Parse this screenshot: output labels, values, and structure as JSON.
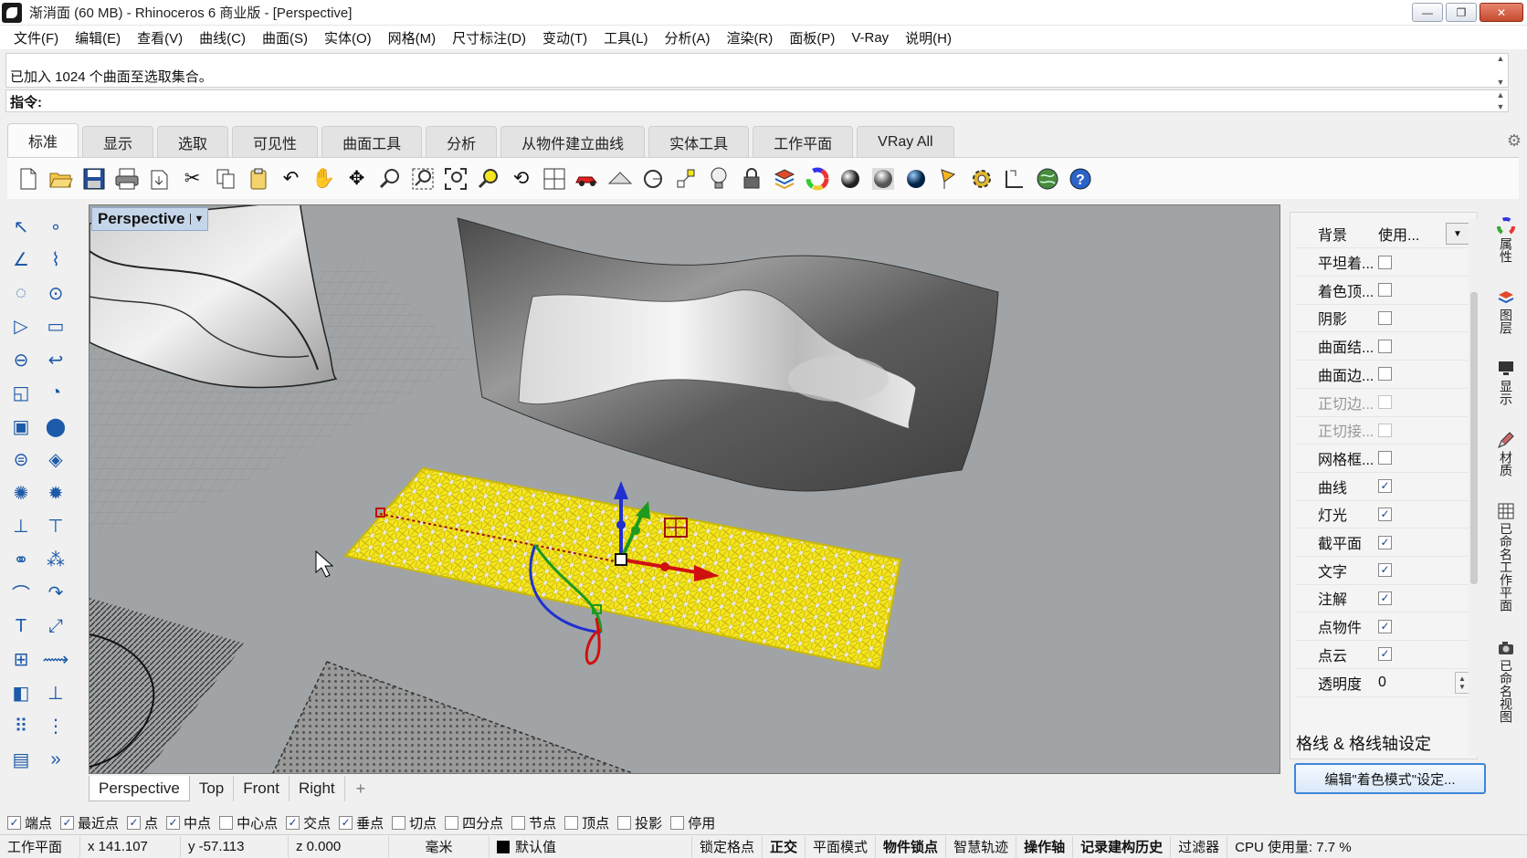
{
  "window": {
    "title": "渐消面 (60 MB) - Rhinoceros 6 商业版 - [Perspective]",
    "buttons": {
      "minimize": "—",
      "restore": "❐",
      "close": "✕"
    }
  },
  "menu": [
    "文件(F)",
    "编辑(E)",
    "查看(V)",
    "曲线(C)",
    "曲面(S)",
    "实体(O)",
    "网格(M)",
    "尺寸标注(D)",
    "变动(T)",
    "工具(L)",
    "分析(A)",
    "渲染(R)",
    "面板(P)",
    "V-Ray",
    "说明(H)"
  ],
  "command": {
    "history": "已加入 1024 个曲面至选取集合。",
    "prompt": "指令:"
  },
  "tabs": [
    "标准",
    "显示",
    "选取",
    "可见性",
    "曲面工具",
    "分析",
    "从物件建立曲线",
    "实体工具",
    "工作平面",
    "VRay All"
  ],
  "toolbar_icons": [
    "new-file-icon",
    "open-icon",
    "save-icon",
    "print-icon",
    "import-icon",
    "cut-icon",
    "copy-icon",
    "paste-icon",
    "undo-icon",
    "pan-icon",
    "rotate-view-icon",
    "zoom-icon",
    "zoom-window-icon",
    "zoom-extents-icon",
    "zoom-selected-icon",
    "rotate-icon",
    "four-views-icon",
    "car-icon",
    "plane-icon",
    "circle-icon",
    "snap-icon",
    "light-icon",
    "lock-icon",
    "layer-icon",
    "color-wheel-icon",
    "sphere-icon",
    "shaded-sphere-icon",
    "render-sphere-icon",
    "flag-icon",
    "gear-icon",
    "dimension-icon",
    "globe-icon",
    "help-icon"
  ],
  "viewport": {
    "label": "Perspective",
    "tabs": [
      "Perspective",
      "Top",
      "Front",
      "Right"
    ],
    "add_tab": "+"
  },
  "display_panel": {
    "background_label": "背景",
    "background_value": "使用...",
    "rows": [
      {
        "label": "平坦着...",
        "checked": false,
        "dim": false
      },
      {
        "label": "着色顶...",
        "checked": false,
        "dim": false
      },
      {
        "label": "阴影",
        "checked": false,
        "dim": false
      },
      {
        "label": "曲面结...",
        "checked": false,
        "dim": false
      },
      {
        "label": "曲面边...",
        "checked": false,
        "dim": false
      },
      {
        "label": "正切边...",
        "checked": false,
        "dim": true
      },
      {
        "label": "正切接...",
        "checked": false,
        "dim": true
      },
      {
        "label": "网格框...",
        "checked": false,
        "dim": false
      },
      {
        "label": "曲线",
        "checked": true,
        "dim": false
      },
      {
        "label": "灯光",
        "checked": true,
        "dim": false
      },
      {
        "label": "截平面",
        "checked": true,
        "dim": false
      },
      {
        "label": "文字",
        "checked": true,
        "dim": false
      },
      {
        "label": "注解",
        "checked": true,
        "dim": false
      },
      {
        "label": "点物件",
        "checked": true,
        "dim": false
      },
      {
        "label": "点云",
        "checked": true,
        "dim": false
      }
    ],
    "transparency_label": "透明度",
    "transparency_value": "0",
    "section": "格线 & 格线轴设定",
    "edit_button": "编辑\"着色模式\"设定..."
  },
  "right_tabs": [
    "属性",
    "图层",
    "显示",
    "材质",
    "已命名工作平面",
    "已命名视图"
  ],
  "osnap": [
    {
      "label": "端点",
      "checked": true
    },
    {
      "label": "最近点",
      "checked": true
    },
    {
      "label": "点",
      "checked": true
    },
    {
      "label": "中点",
      "checked": true
    },
    {
      "label": "中心点",
      "checked": false
    },
    {
      "label": "交点",
      "checked": true
    },
    {
      "label": "垂点",
      "checked": true
    },
    {
      "label": "切点",
      "checked": false
    },
    {
      "label": "四分点",
      "checked": false
    },
    {
      "label": "节点",
      "checked": false
    },
    {
      "label": "顶点",
      "checked": false
    },
    {
      "label": "投影",
      "checked": false
    },
    {
      "label": "停用",
      "checked": false
    }
  ],
  "status": {
    "cplane": "工作平面",
    "x": "x 141.107",
    "y": "y -57.113",
    "z": "z 0.000",
    "unit": "毫米",
    "layer": "默认值",
    "grid_snap": "锁定格点",
    "ortho": "正交",
    "planar": "平面模式",
    "osnap": "物件锁点",
    "smarttrack": "智慧轨迹",
    "gumball": "操作轴",
    "history": "记录建构历史",
    "filter": "过滤器",
    "cpu": "CPU 使用量: 7.7 %"
  },
  "colors": {
    "viewport_bg": "#a0a4a6",
    "selection": "#f5e51f",
    "accent": "#3d86d6"
  }
}
